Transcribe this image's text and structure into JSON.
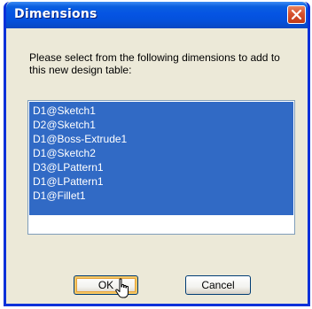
{
  "window": {
    "title": "Dimensions",
    "close_icon": "close-x-icon"
  },
  "prompt": {
    "text": "Please select from the following dimensions to add to this new design table:"
  },
  "dimension_list": {
    "items": [
      {
        "label": "D1@Sketch1",
        "selected": true
      },
      {
        "label": "D2@Sketch1",
        "selected": true
      },
      {
        "label": "D1@Boss-Extrude1",
        "selected": true
      },
      {
        "label": "D1@Sketch2",
        "selected": true
      },
      {
        "label": "D3@LPattern1",
        "selected": true
      },
      {
        "label": "D1@LPattern1",
        "selected": true
      },
      {
        "label": "D1@Fillet1",
        "selected": true
      }
    ]
  },
  "buttons": {
    "ok_label": "OK",
    "cancel_label": "Cancel"
  },
  "colors": {
    "titlebar": "#0554e3",
    "selection": "#316ac5",
    "dialog_bg": "#ece9d8",
    "close_button": "#d6512e"
  }
}
